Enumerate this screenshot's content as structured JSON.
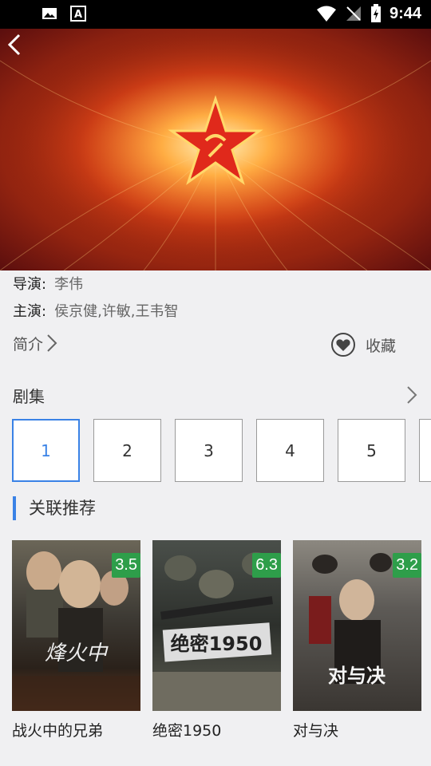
{
  "status_bar": {
    "time": "9:44"
  },
  "hero": {
    "back_icon": "back-arrow-icon"
  },
  "info": {
    "director_key": "导演:",
    "director": "李伟",
    "cast_key": "主演:",
    "cast": "侯京健,许敏,王韦智"
  },
  "intro_label": "简介",
  "favorite_label": "收藏",
  "episodes": {
    "title": "剧集",
    "items": [
      "1",
      "2",
      "3",
      "4",
      "5"
    ]
  },
  "recommend": {
    "title": "关联推荐",
    "items": [
      {
        "title": "战火中的兄弟",
        "score": "3.5"
      },
      {
        "title": "绝密1950",
        "score": "6.3"
      },
      {
        "title": "对与决",
        "score": "3.2"
      }
    ]
  },
  "colors": {
    "accent": "#3a82e6",
    "score_bg": "#2e9e4a"
  }
}
